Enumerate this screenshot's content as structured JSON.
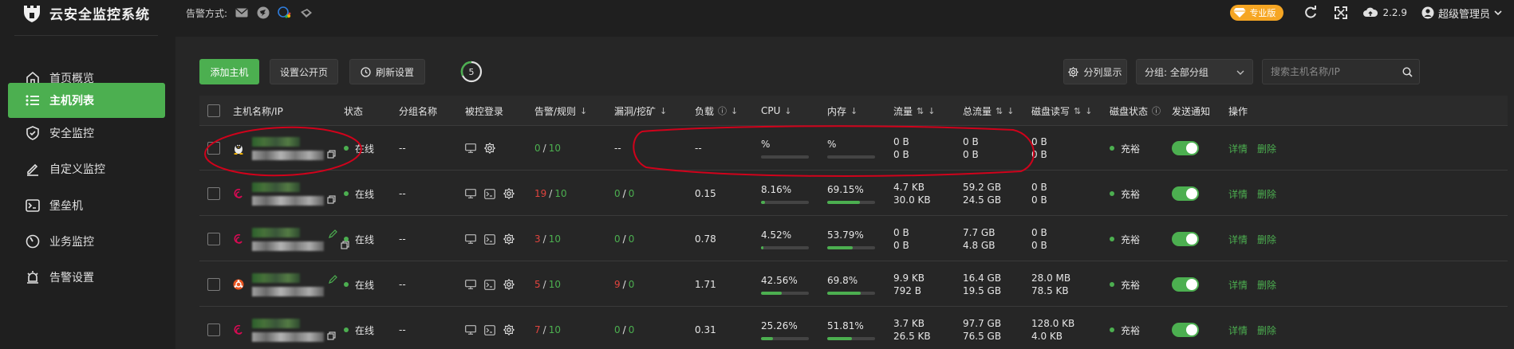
{
  "app": {
    "title": "云安全监控系统"
  },
  "topbar": {
    "alarm_label": "告警方式:",
    "alarm_icons": [
      "email-icon",
      "dingtalk-icon",
      "wecom-icon",
      "feishu-icon"
    ],
    "pro_badge": "专业版",
    "version": "2.2.9",
    "admin_name": "超级管理员"
  },
  "sidebar": {
    "items": [
      {
        "label": "首页概览",
        "icon": "home-icon",
        "active": false
      },
      {
        "label": "主机列表",
        "icon": "list-icon",
        "active": true
      },
      {
        "label": "安全监控",
        "icon": "shield-icon",
        "active": false
      },
      {
        "label": "自定义监控",
        "icon": "edit-icon",
        "active": false
      },
      {
        "label": "堡垒机",
        "icon": "terminal-icon",
        "active": false
      },
      {
        "label": "业务监控",
        "icon": "gauge-icon",
        "active": false
      },
      {
        "label": "告警设置",
        "icon": "alarm-icon",
        "active": false
      }
    ]
  },
  "toolbar": {
    "add_host": "添加主机",
    "public_page": "设置公开页",
    "refresh_settings": "刷新设置",
    "refresh_count": "5",
    "split_display": "分列显示",
    "group_select": "分组: 全部分组",
    "search_placeholder": "搜索主机名称/IP"
  },
  "columns": {
    "name": "主机名称/IP",
    "status": "状态",
    "group": "分组名称",
    "remote": "被控登录",
    "alarm": "告警/规则",
    "vuln": "漏洞/挖矿",
    "load": "负载",
    "cpu": "CPU",
    "mem": "内存",
    "flow": "流量",
    "total_flow": "总流量",
    "disk_rw": "磁盘读写",
    "disk_status": "磁盘状态",
    "notify": "发送通知",
    "action": "操作"
  },
  "rows": [
    {
      "os": "linux-icon",
      "status": "在线",
      "group": "--",
      "alarm_a": "0",
      "alarm_b": "10",
      "alarm_red": false,
      "vuln": "--",
      "vuln_a": "",
      "vuln_b": "",
      "vuln_red": false,
      "load": "--",
      "cpu": "%",
      "cpu_pct": 0,
      "mem": "%",
      "mem_pct": 0,
      "flow_up": "0 B",
      "flow_down": "0 B",
      "total_up": "0 B",
      "total_down": "0 B",
      "disk_r": "0 B",
      "disk_w": "0 B",
      "disk_status": "充裕",
      "detail": "详情",
      "delete": "删除"
    },
    {
      "os": "debian-icon",
      "status": "在线",
      "group": "--",
      "alarm_a": "19",
      "alarm_b": "10",
      "alarm_red": true,
      "vuln": "",
      "vuln_a": "0",
      "vuln_b": "0",
      "vuln_red": false,
      "load": "0.15",
      "cpu": "8.16%",
      "cpu_pct": 8.16,
      "mem": "69.15%",
      "mem_pct": 69.15,
      "flow_up": "4.7 KB",
      "flow_down": "30.0 KB",
      "total_up": "59.2 GB",
      "total_down": "24.5 GB",
      "disk_r": "0 B",
      "disk_w": "0 B",
      "disk_status": "充裕",
      "detail": "详情",
      "delete": "删除"
    },
    {
      "os": "debian-icon",
      "status": "在线",
      "group": "--",
      "alarm_a": "3",
      "alarm_b": "10",
      "alarm_red": true,
      "vuln": "",
      "vuln_a": "0",
      "vuln_b": "0",
      "vuln_red": false,
      "load": "0.78",
      "cpu": "4.52%",
      "cpu_pct": 4.52,
      "mem": "53.79%",
      "mem_pct": 53.79,
      "flow_up": "0 B",
      "flow_down": "0 B",
      "total_up": "7.7 GB",
      "total_down": "4.8 GB",
      "disk_r": "0 B",
      "disk_w": "0 B",
      "disk_status": "充裕",
      "detail": "详情",
      "delete": "删除"
    },
    {
      "os": "ubuntu-icon",
      "status": "在线",
      "group": "--",
      "alarm_a": "5",
      "alarm_b": "10",
      "alarm_red": true,
      "vuln": "",
      "vuln_a": "9",
      "vuln_b": "0",
      "vuln_red": true,
      "load": "1.71",
      "cpu": "42.56%",
      "cpu_pct": 42.56,
      "mem": "69.8%",
      "mem_pct": 69.8,
      "flow_up": "9.9 KB",
      "flow_down": "792 B",
      "total_up": "16.4 GB",
      "total_down": "19.5 GB",
      "disk_r": "28.0 MB",
      "disk_w": "78.5 KB",
      "disk_status": "充裕",
      "detail": "详情",
      "delete": "删除"
    },
    {
      "os": "debian-icon",
      "status": "在线",
      "group": "--",
      "alarm_a": "7",
      "alarm_b": "10",
      "alarm_red": true,
      "vuln": "",
      "vuln_a": "0",
      "vuln_b": "0",
      "vuln_red": false,
      "load": "0.31",
      "cpu": "25.26%",
      "cpu_pct": 25.26,
      "mem": "51.81%",
      "mem_pct": 51.81,
      "flow_up": "3.7 KB",
      "flow_down": "26.5 KB",
      "total_up": "97.7 GB",
      "total_down": "76.5 GB",
      "disk_r": "128.0 KB",
      "disk_w": "4.0 KB",
      "disk_status": "充裕",
      "detail": "详情",
      "delete": "删除"
    }
  ],
  "colors": {
    "accent": "#4caf50",
    "danger": "#e0443e",
    "pro": "#f6a623",
    "annotation": "#d0021b"
  }
}
